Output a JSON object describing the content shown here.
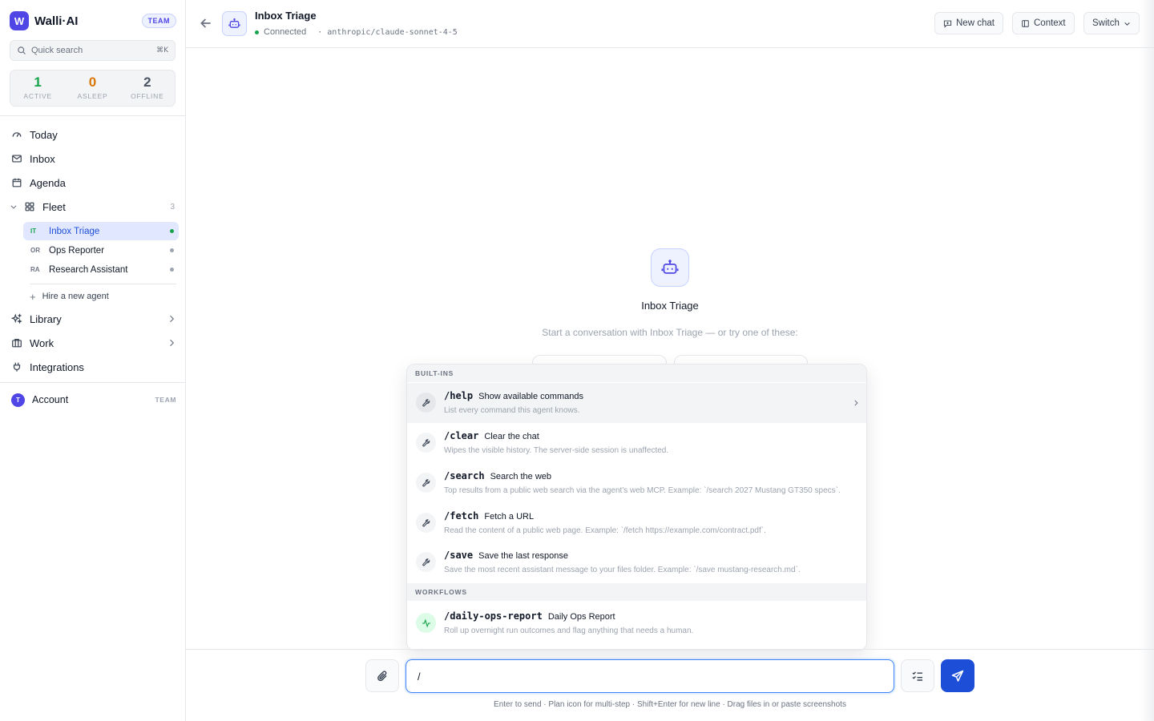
{
  "brand": {
    "logo_letter": "W",
    "name": "Walli·AI",
    "badge": "TEAM",
    "accent": "#4f46e5"
  },
  "search": {
    "label": "Quick search",
    "shortcut": "⌘K"
  },
  "stats": [
    {
      "value": "1",
      "label": "ACTIVE",
      "color": "#16a34a"
    },
    {
      "value": "0",
      "label": "ASLEEP",
      "color": "#d97706"
    },
    {
      "value": "2",
      "label": "OFFLINE",
      "color": "#4b5563"
    }
  ],
  "nav": {
    "today": "Today",
    "inbox": "Inbox",
    "agenda": "Agenda",
    "fleet": "Fleet",
    "fleet_count": "3",
    "library": "Library",
    "work": "Work",
    "integrations": "Integrations"
  },
  "fleet": [
    {
      "abbr": "IT",
      "name": "Inbox Triage",
      "status": "active"
    },
    {
      "abbr": "OR",
      "name": "Ops Reporter",
      "status": "offline"
    },
    {
      "abbr": "RA",
      "name": "Research Assistant",
      "status": "offline"
    }
  ],
  "hire": "Hire a new agent",
  "account": {
    "initial": "T",
    "label": "Account",
    "badge": "TEAM"
  },
  "header": {
    "title": "Inbox Triage",
    "status": "Connected",
    "model": "· anthropic/claude-sonnet-4-5",
    "new_chat": "New chat",
    "context": "Context",
    "switch": "Switch"
  },
  "empty": {
    "title": "Inbox Triage",
    "subtitle": "Start a conversation with Inbox Triage — or try one of these:"
  },
  "commands": {
    "builtins_label": "BUILT-INS",
    "builtins": [
      {
        "name": "/help",
        "title": "Show available commands",
        "desc": "List every command this agent knows."
      },
      {
        "name": "/clear",
        "title": "Clear the chat",
        "desc": "Wipes the visible history. The server-side session is unaffected."
      },
      {
        "name": "/search",
        "title": "Search the web",
        "desc": "Top results from a public web search via the agent's web MCP. Example: `/search 2027 Mustang GT350 specs`."
      },
      {
        "name": "/fetch",
        "title": "Fetch a URL",
        "desc": "Read the content of a public web page. Example: `/fetch https://example.com/contract.pdf`."
      },
      {
        "name": "/save",
        "title": "Save the last response",
        "desc": "Save the most recent assistant message to your files folder. Example: `/save mustang-research.md`."
      }
    ],
    "workflows_label": "WORKFLOWS",
    "workflows": [
      {
        "name": "/daily-ops-report",
        "title": "Daily Ops Report",
        "desc": "Roll up overnight run outcomes and flag anything that needs a human."
      }
    ]
  },
  "composer": {
    "value": "/",
    "hint": "Enter to send · Plan icon for multi-step · Shift+Enter for new line · Drag files in or paste screenshots"
  }
}
